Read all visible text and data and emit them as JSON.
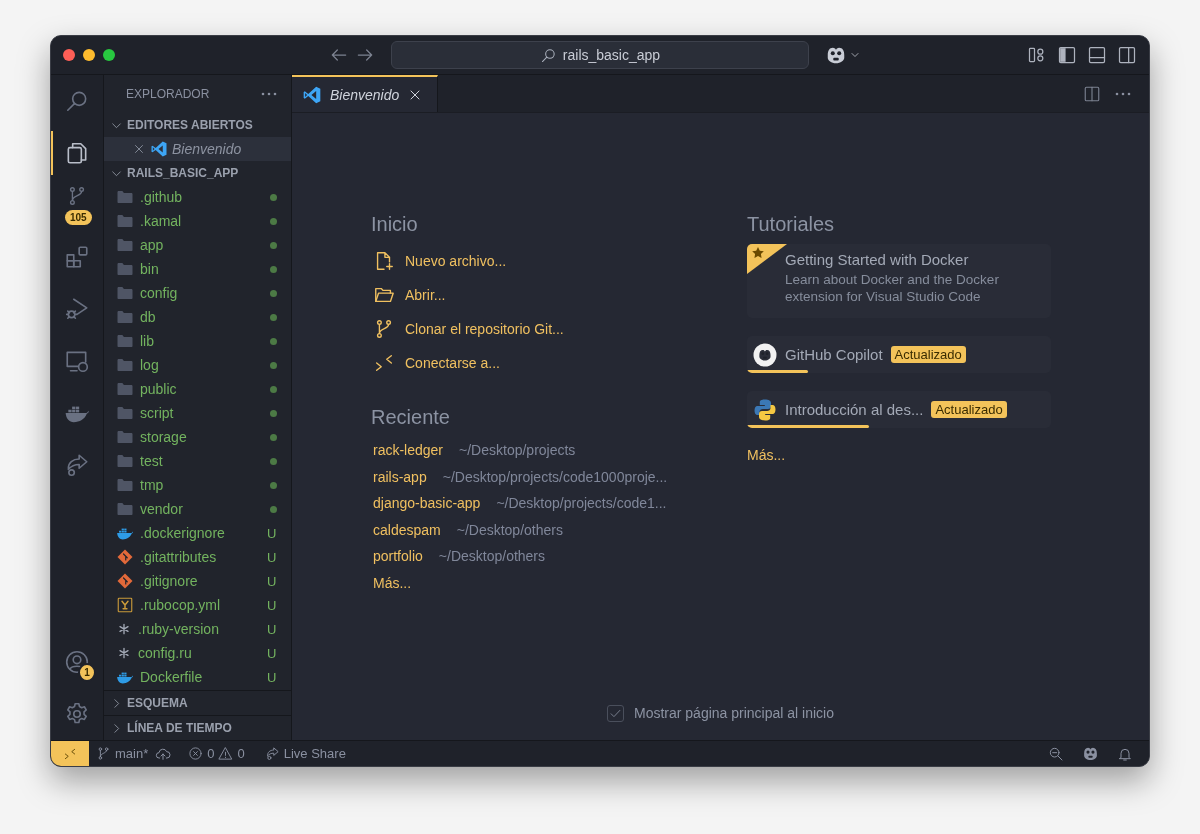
{
  "title_bar": {
    "search": "rails_basic_app"
  },
  "activity_bar": {
    "top": [
      {
        "kind": "search",
        "selected": false
      },
      {
        "kind": "explorer",
        "selected": true
      },
      {
        "kind": "source_control",
        "selected": false,
        "badge": "105"
      },
      {
        "kind": "extensions",
        "selected": false
      },
      {
        "kind": "run_debug",
        "selected": false
      },
      {
        "kind": "remote_explorer",
        "selected": false
      },
      {
        "kind": "docker",
        "selected": false
      },
      {
        "kind": "live_share",
        "selected": false
      }
    ],
    "bottom": [
      {
        "kind": "accounts",
        "badge": "1"
      },
      {
        "kind": "settings"
      }
    ]
  },
  "sidebar": {
    "title": "EXPLORADOR",
    "open_editors": {
      "label": "EDITORES ABIERTOS",
      "expanded": true,
      "items": [
        {
          "label": "Bienvenido",
          "selected": true
        }
      ]
    },
    "folder": {
      "label": "RAILS_BASIC_APP",
      "expanded": true,
      "items": [
        {
          "kind": "folder",
          "label": ".github",
          "dot": true
        },
        {
          "kind": "folder",
          "label": ".kamal",
          "dot": true
        },
        {
          "kind": "folder",
          "label": "app",
          "dot": true
        },
        {
          "kind": "folder",
          "label": "bin",
          "dot": true
        },
        {
          "kind": "folder",
          "label": "config",
          "dot": true
        },
        {
          "kind": "folder",
          "label": "db",
          "dot": true
        },
        {
          "kind": "folder",
          "label": "lib",
          "dot": true
        },
        {
          "kind": "folder",
          "label": "log",
          "dot": true
        },
        {
          "kind": "folder",
          "label": "public",
          "dot": true
        },
        {
          "kind": "folder",
          "label": "script",
          "dot": true
        },
        {
          "kind": "folder",
          "label": "storage",
          "dot": true
        },
        {
          "kind": "folder",
          "label": "test",
          "dot": true
        },
        {
          "kind": "folder",
          "label": "tmp",
          "dot": true
        },
        {
          "kind": "folder",
          "label": "vendor",
          "dot": true
        },
        {
          "kind": "docker",
          "label": ".dockerignore",
          "status": "U"
        },
        {
          "kind": "git",
          "label": ".gitattributes",
          "status": "U"
        },
        {
          "kind": "git",
          "label": ".gitignore",
          "status": "U"
        },
        {
          "kind": "yaml",
          "label": ".rubocop.yml",
          "status": "U"
        },
        {
          "kind": "config",
          "label": ".ruby-version",
          "status": "U"
        },
        {
          "kind": "config",
          "label": "config.ru",
          "status": "U"
        },
        {
          "kind": "docker",
          "label": "Dockerfile",
          "status": "U"
        }
      ]
    },
    "collapsed_sections": [
      {
        "label": "ESQUEMA",
        "expanded": false
      },
      {
        "label": "LÍNEA DE TIEMPO",
        "expanded": false
      }
    ]
  },
  "tabs": [
    {
      "label": "Bienvenido",
      "selected": true
    }
  ],
  "welcome": {
    "start": {
      "title": "Inicio",
      "items": [
        {
          "kind": "new_file",
          "label": "Nuevo archivo..."
        },
        {
          "kind": "open",
          "label": "Abrir..."
        },
        {
          "kind": "clone",
          "label": "Clonar el repositorio Git..."
        },
        {
          "kind": "connect",
          "label": "Conectarse a..."
        }
      ]
    },
    "recent": {
      "title": "Reciente",
      "items": [
        {
          "name": "rack-ledger",
          "path": "~/Desktop/projects"
        },
        {
          "name": "rails-app",
          "path": "~/Desktop/projects/code1000proje..."
        },
        {
          "name": "django-basic-app",
          "path": "~/Desktop/projects/code1..."
        },
        {
          "name": "caldespam",
          "path": "~/Desktop/others"
        },
        {
          "name": "portfolio",
          "path": "~/Desktop/others"
        }
      ],
      "more": "Más..."
    },
    "tutorials": {
      "title": "Tutoriales",
      "items": [
        {
          "kind": "featured",
          "title": "Getting Started with Docker",
          "description": "Learn about Docker and the Docker extension for Visual Studio Code"
        },
        {
          "kind": "copilot",
          "title": "GitHub Copilot",
          "badge": "Actualizado",
          "level": 0.2
        },
        {
          "kind": "python",
          "title": "Introducción al des...",
          "badge": "Actualizado",
          "level": 0.4
        }
      ],
      "more": "Más..."
    },
    "show_on_startup": {
      "label": "Mostrar página principal al inicio",
      "checked": true
    }
  },
  "status_bar": {
    "branch": "main*",
    "errors": "0",
    "warnings": "0",
    "live_share": "Live Share"
  }
}
